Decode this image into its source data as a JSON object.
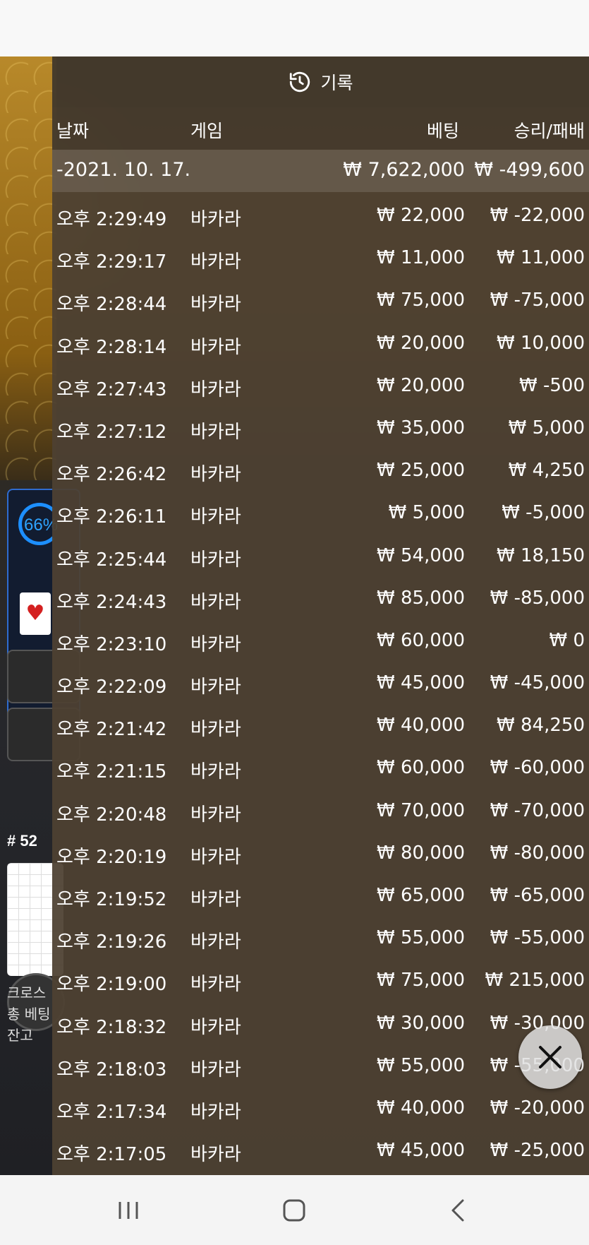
{
  "panel": {
    "title": "기록",
    "title_icon": "history-icon"
  },
  "columns": {
    "date": "날짜",
    "game": "게임",
    "bet": "베팅",
    "result": "승리/패배"
  },
  "date_group": {
    "date": "-2021. 10. 17.",
    "total_bet": "₩ 7,622,000",
    "total_result": "₩ -499,600"
  },
  "rows": [
    {
      "time": "오후 2:29:49",
      "game": "바카라",
      "bet": "₩ 22,000",
      "result": "₩ -22,000"
    },
    {
      "time": "오후 2:29:17",
      "game": "바카라",
      "bet": "₩ 11,000",
      "result": "₩ 11,000"
    },
    {
      "time": "오후 2:28:44",
      "game": "바카라",
      "bet": "₩ 75,000",
      "result": "₩ -75,000"
    },
    {
      "time": "오후 2:28:14",
      "game": "바카라",
      "bet": "₩ 20,000",
      "result": "₩ 10,000"
    },
    {
      "time": "오후 2:27:43",
      "game": "바카라",
      "bet": "₩ 20,000",
      "result": "₩ -500"
    },
    {
      "time": "오후 2:27:12",
      "game": "바카라",
      "bet": "₩ 35,000",
      "result": "₩ 5,000"
    },
    {
      "time": "오후 2:26:42",
      "game": "바카라",
      "bet": "₩ 25,000",
      "result": "₩ 4,250"
    },
    {
      "time": "오후 2:26:11",
      "game": "바카라",
      "bet": "₩ 5,000",
      "result": "₩ -5,000"
    },
    {
      "time": "오후 2:25:44",
      "game": "바카라",
      "bet": "₩ 54,000",
      "result": "₩ 18,150"
    },
    {
      "time": "오후 2:24:43",
      "game": "바카라",
      "bet": "₩ 85,000",
      "result": "₩ -85,000"
    },
    {
      "time": "오후 2:23:10",
      "game": "바카라",
      "bet": "₩ 60,000",
      "result": "₩ 0"
    },
    {
      "time": "오후 2:22:09",
      "game": "바카라",
      "bet": "₩ 45,000",
      "result": "₩ -45,000"
    },
    {
      "time": "오후 2:21:42",
      "game": "바카라",
      "bet": "₩ 40,000",
      "result": "₩ 84,250"
    },
    {
      "time": "오후 2:21:15",
      "game": "바카라",
      "bet": "₩ 60,000",
      "result": "₩ -60,000"
    },
    {
      "time": "오후 2:20:48",
      "game": "바카라",
      "bet": "₩ 70,000",
      "result": "₩ -70,000"
    },
    {
      "time": "오후 2:20:19",
      "game": "바카라",
      "bet": "₩ 80,000",
      "result": "₩ -80,000"
    },
    {
      "time": "오후 2:19:52",
      "game": "바카라",
      "bet": "₩ 65,000",
      "result": "₩ -65,000"
    },
    {
      "time": "오후 2:19:26",
      "game": "바카라",
      "bet": "₩ 55,000",
      "result": "₩ -55,000"
    },
    {
      "time": "오후 2:19:00",
      "game": "바카라",
      "bet": "₩ 75,000",
      "result": "₩ 215,000"
    },
    {
      "time": "오후 2:18:32",
      "game": "바카라",
      "bet": "₩ 30,000",
      "result": "₩ -30,000"
    },
    {
      "time": "오후 2:18:03",
      "game": "바카라",
      "bet": "₩ 55,000",
      "result": "₩ -55,000"
    },
    {
      "time": "오후 2:17:34",
      "game": "바카라",
      "bet": "₩ 40,000",
      "result": "₩ -20,000"
    },
    {
      "time": "오후 2:17:05",
      "game": "바카라",
      "bet": "₩ 45,000",
      "result": "₩ -25,000"
    }
  ],
  "background": {
    "percent": "66%",
    "round": "# 52",
    "footer_lines": [
      "크로스",
      "총 베팅",
      "잔고"
    ]
  },
  "close_icon": "close-icon",
  "nav": {
    "recents_icon": "recent-apps-icon",
    "home_icon": "home-icon",
    "back_icon": "back-icon"
  }
}
